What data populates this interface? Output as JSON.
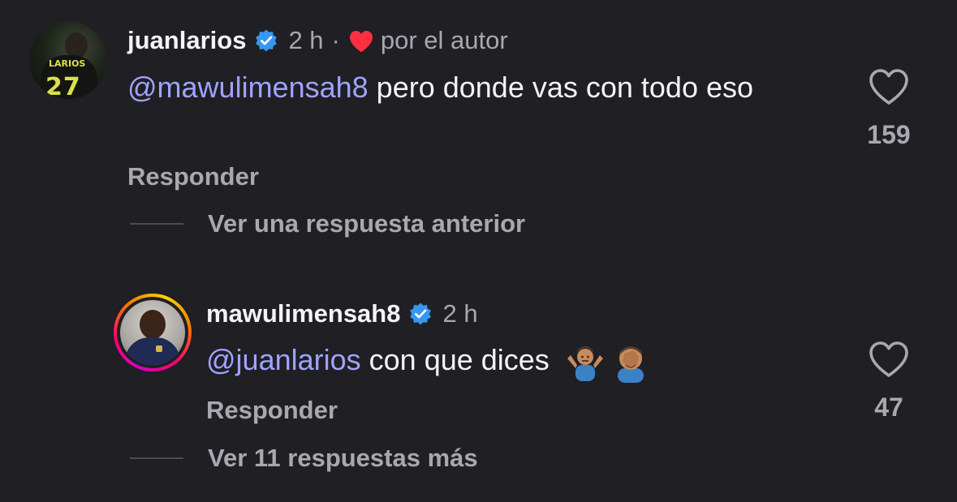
{
  "comments": [
    {
      "username": "juanlarios",
      "verified": true,
      "time": "2 h",
      "separator": "·",
      "liked_by_author": true,
      "liked_by_author_label": "por el autor",
      "mention": "@mawulimensah8",
      "text": " pero donde vas con todo eso",
      "reply_label": "Responder",
      "like_count": "159",
      "thread_toggle": "Ver una respuesta anterior",
      "avatar_jersey_name": "LARIOS",
      "avatar_jersey_number": "27",
      "icons": {
        "verified": "verified-badge-icon",
        "author_heart": "heart-filled-icon",
        "like": "heart-outline-icon"
      }
    },
    {
      "username": "mawulimensah8",
      "verified": true,
      "time": "2 h",
      "mention": "@juanlarios",
      "text": " con que dices ",
      "emojis": [
        "man-shrugging",
        "man-facepalming"
      ],
      "reply_label": "Responder",
      "like_count": "47",
      "thread_toggle": "Ver 11 respuestas más",
      "has_story_ring": true,
      "icons": {
        "verified": "verified-badge-icon",
        "like": "heart-outline-icon"
      }
    }
  ],
  "colors": {
    "background": "#1f1f24",
    "mention": "#a0a3ff",
    "muted_text": "#a8a8ae",
    "verified_blue": "#3797f0",
    "heart_red": "#ff3040"
  }
}
